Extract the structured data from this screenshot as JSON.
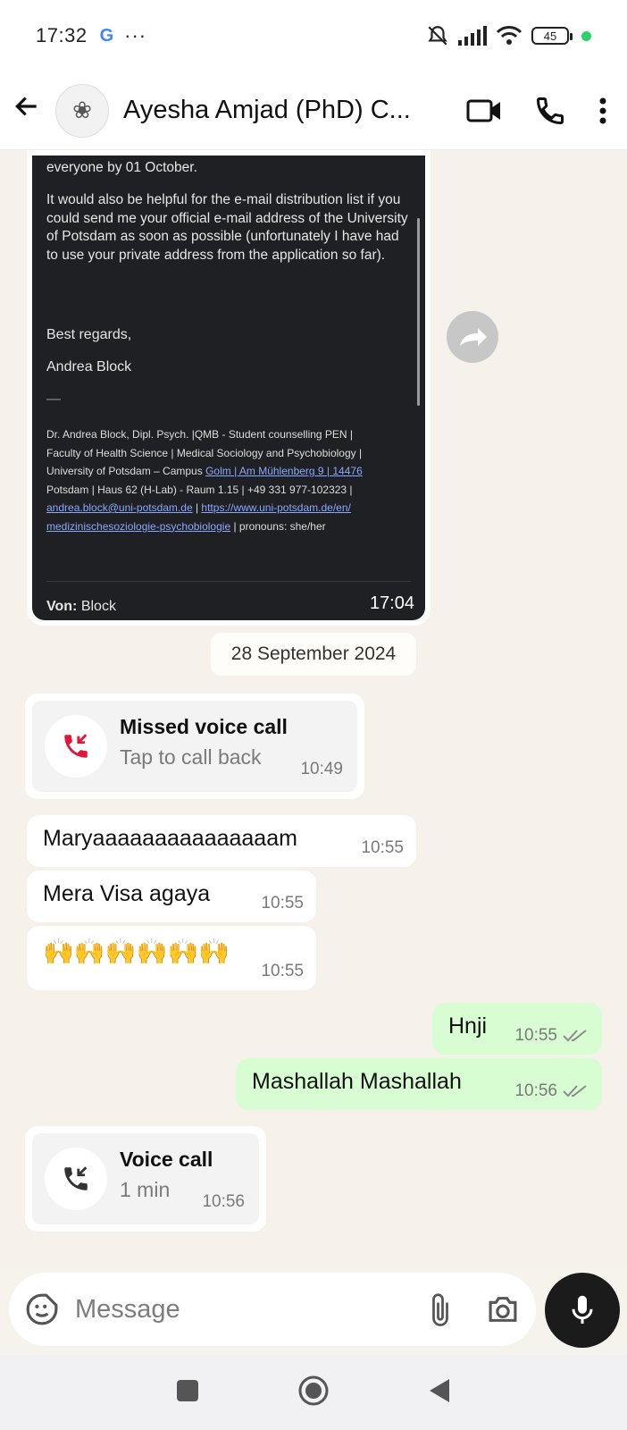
{
  "status": {
    "time": "17:32",
    "google_glyph": "G",
    "more_glyph": "···",
    "battery": "45",
    "icons": [
      "mute-icon",
      "signal-icon",
      "wifi-icon",
      "battery-icon"
    ]
  },
  "header": {
    "title": "Ayesha Amjad (PhD) C...",
    "avatar_glyph": "❀"
  },
  "email": {
    "line1": "everyone by 01 October.",
    "paragraph": "It would also be helpful for the e-mail distribution list if you could send me your official e-mail address of the University of Potsdam as soon as possible (unfortunately I have had to use your private address from the application so far).",
    "regards": "Best regards,",
    "name": "Andrea Block",
    "dash": "—",
    "sig_line1": "Dr. Andrea Block, Dipl. Psych. |QMB -  Student counselling PEN |",
    "sig_line2": "Faculty of Health Science | Medical Sociology and Psychobiology |",
    "sig_line3_prefix": "University of Potsdam – Campus ",
    "sig_line3_link": "Golm | Am Mühlenberg 9 | 14476",
    "sig_line4": "Potsdam | Haus 62 (H-Lab) - Raum 1.15 | +49 331 977-102323 |",
    "sig_email": "andrea.block@uni-potsdam.de",
    "sig_sep": " | ",
    "sig_url1": "https://www.uni-potsdam.de/en/",
    "sig_url2": "medizinischesoziologie-psychobiologie",
    "sig_pronouns": " | pronouns: she/her",
    "von_label": "Von:",
    "von_value": "Block",
    "time": "17:04"
  },
  "date_divider": "28 September 2024",
  "messages": [
    {
      "type": "call",
      "title": "Missed voice call",
      "subtitle": "Tap to call back",
      "time": "10:49"
    },
    {
      "type": "in",
      "text": "Maryaaaaaaaaaaaaaaam",
      "time": "10:55"
    },
    {
      "type": "in",
      "text": "Mera Visa agaya",
      "time": "10:55"
    },
    {
      "type": "in",
      "text": "🙌🙌🙌🙌🙌🙌",
      "time": "10:55"
    },
    {
      "type": "out",
      "text": "Hnji",
      "time": "10:55"
    },
    {
      "type": "out",
      "text": "Mashallah Mashallah",
      "time": "10:56"
    },
    {
      "type": "call",
      "title": "Voice call",
      "subtitle": "1 min",
      "time": "10:56"
    }
  ],
  "input": {
    "placeholder": "Message"
  },
  "colors": {
    "chat_bg": "#f6f1ea",
    "outgoing": "#d9fdd3",
    "missed_call": "#e0173b",
    "accent_green": "#2bd36b"
  }
}
